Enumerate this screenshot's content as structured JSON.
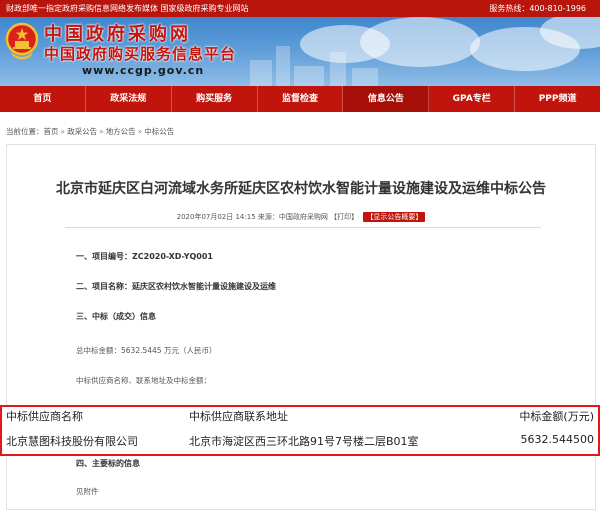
{
  "topbar": {
    "left": "财政部唯一指定政府采购信息网络发布媒体 国家级政府采购专业网站",
    "right": "服务热线：400-810-1996"
  },
  "header": {
    "title": "中国政府采购网",
    "subtitle": "中国政府购买服务信息平台",
    "url": "www.ccgp.gov.cn",
    "emblem_icon": "national-emblem-icon"
  },
  "nav": {
    "items": [
      "首页",
      "政采法规",
      "购买服务",
      "监督检查",
      "信息公告",
      "GPA专栏",
      "PPP频道"
    ],
    "active": "信息公告"
  },
  "breadcrumb": {
    "prefix": "当前位置：",
    "items": [
      "首页",
      "政采公告",
      "地方公告",
      "中标公告"
    ],
    "separator": "»"
  },
  "article": {
    "title": "北京市延庆区白河流域水务所延庆区农村饮水智能计量设施建设及运维中标公告",
    "date": "2020年07月02日 14:15",
    "source_label": "来源：中国政府采购网",
    "print_label": "【打印】",
    "summary_label": "【显示公告概要】",
    "lines": [
      "一、项目编号：ZC2020-XD-YQ001",
      "二、项目名称：延庆区农村饮水智能计量设施建设及运维",
      "三、中标（成交）信息",
      "总中标金额：5632.5445 万元（人民币）",
      "中标供应商名称、联系地址及中标金额："
    ],
    "line_after_table": "四、主要标的信息",
    "attachment": "见附件"
  },
  "winner_table": {
    "headers": [
      "中标供应商名称",
      "中标供应商联系地址",
      "中标金额(万元)"
    ],
    "rows": [
      [
        "北京慧图科技股份有限公司",
        "北京市海淀区西三环北路91号7号楼二层B01室",
        "5632.544500"
      ]
    ]
  },
  "colors": {
    "brand_red": "#c0140c",
    "highlight_border": "#e01919",
    "banner_blue": "#4a8fd3"
  }
}
